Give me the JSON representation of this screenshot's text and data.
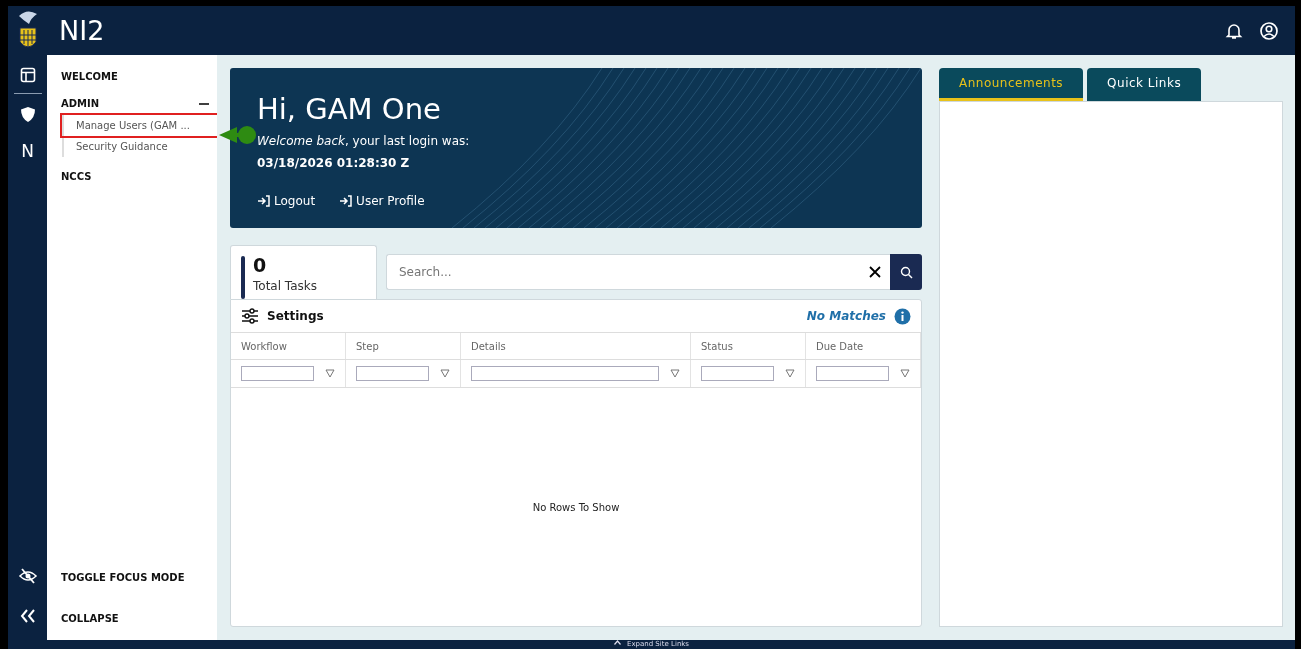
{
  "app": {
    "title": "NI2"
  },
  "rail": {
    "letter_icon": "N"
  },
  "sidebar": {
    "sections": [
      {
        "label": "WELCOME"
      },
      {
        "label": "ADMIN",
        "expanded": true,
        "children": [
          {
            "label": "Manage Users (GAM ...",
            "highlighted": true
          },
          {
            "label": "Security Guidance",
            "highlighted": false
          }
        ]
      },
      {
        "label": "NCCS"
      }
    ],
    "footer_items": [
      {
        "label": "TOGGLE FOCUS MODE",
        "kind": "focus"
      },
      {
        "label": "COLLAPSE",
        "kind": "collapse"
      }
    ]
  },
  "welcome": {
    "greeting": "Hi, GAM One",
    "message": "*Welcome back*, your last login was:",
    "last_login": "03/18/2026 01:28:30 Z",
    "links": [
      {
        "label": "Logout"
      },
      {
        "label": "User Profile"
      }
    ]
  },
  "tasks": {
    "count": "0",
    "count_label": "Total Tasks",
    "search": {
      "placeholder": "Search..."
    },
    "settings_label": "Settings",
    "match_status": "No Matches",
    "columns": [
      {
        "label": "Workflow"
      },
      {
        "label": "Step"
      },
      {
        "label": "Details"
      },
      {
        "label": "Status"
      },
      {
        "label": "Due Date"
      }
    ],
    "empty_message": "No Rows To Show"
  },
  "side_tabs": [
    {
      "label": "Announcements",
      "selected": true
    },
    {
      "label": "Quick Links",
      "selected": false
    }
  ],
  "footer": {
    "label": "Expand Site Links"
  }
}
